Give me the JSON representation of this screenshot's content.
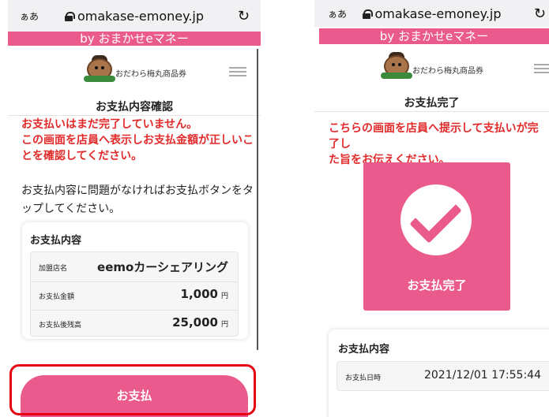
{
  "browser": {
    "aa_label": "ぁあ",
    "url": "omakase-emoney.jp",
    "reload_icon": "↻"
  },
  "byline": "by おまかせeマネー",
  "brand_name": "おだわら梅丸商品券",
  "left": {
    "title": "お支払内容確認",
    "warning_lines": [
      "お支払いはまだ完了していません。",
      "この画面を店員へ表示しお支払金額が正しいこ",
      "とを確認してください。"
    ],
    "instruction_lines": [
      "お支払内容に問題がなければお支払ボタンをタ",
      "ップしてください。"
    ],
    "card_title": "お支払内容",
    "rows": [
      {
        "key": "加盟店名",
        "value": "eemoカーシェアリング",
        "unit": ""
      },
      {
        "key": "お支払金額",
        "value": "1,000",
        "unit": "円"
      },
      {
        "key": "お支払後残高",
        "value": "25,000",
        "unit": "円"
      }
    ],
    "pay_button": "お支払"
  },
  "right": {
    "title": "お支払完了",
    "notice_lines": [
      "こちらの画面を店員へ提示して支払いが完了し",
      "た旨をお伝えください。"
    ],
    "done_label": "お支払完了",
    "card_title": "お支払内容",
    "rows": [
      {
        "key": "お支払日時",
        "value": "2021/12/01 17:55:44"
      }
    ]
  },
  "colors": {
    "accent": "#ea5a8c",
    "warning": "#e22a2a",
    "highlight": "#e60012"
  }
}
